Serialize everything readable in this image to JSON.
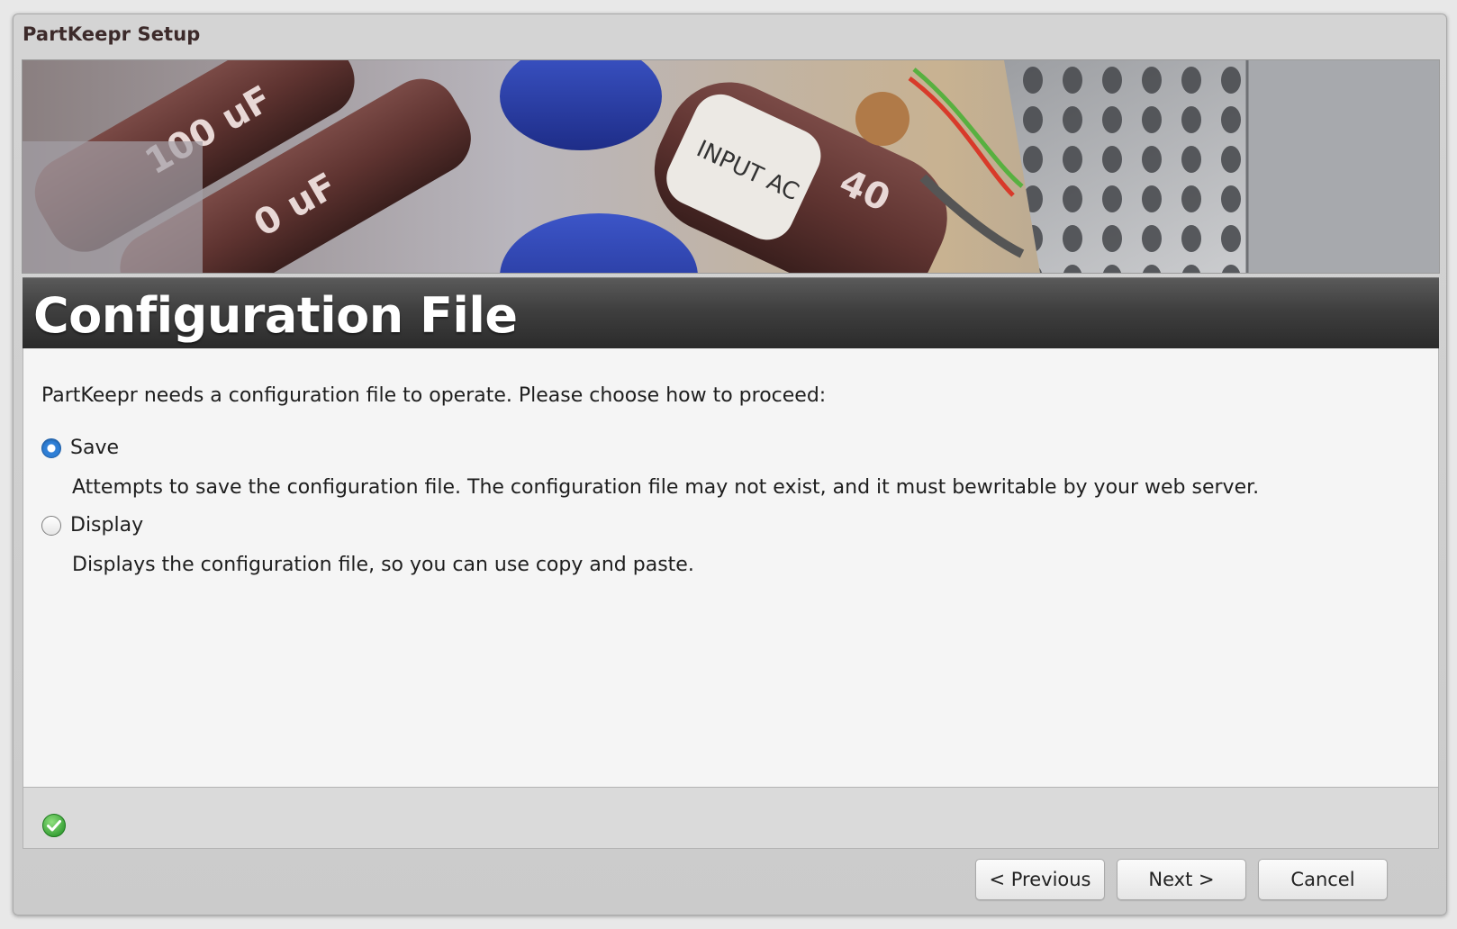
{
  "window": {
    "title": "PartKeepr Setup"
  },
  "banner": {
    "image": "capacitors-photo"
  },
  "step": {
    "heading": "Configuration File"
  },
  "content": {
    "intro": "PartKeepr needs a configuration file to operate. Please choose how to proceed:",
    "options": [
      {
        "label": "Save",
        "description": "Attempts to save the configuration file. The configuration file may not exist, and it must bewritable by your web server.",
        "selected": true
      },
      {
        "label": "Display",
        "description": "Displays the configuration file, so you can use copy and paste.",
        "selected": false
      }
    ]
  },
  "status": {
    "icon": "check-circle-icon",
    "color": "#3aa63a"
  },
  "buttons": {
    "previous": "< Previous",
    "next": "Next >",
    "cancel": "Cancel"
  }
}
